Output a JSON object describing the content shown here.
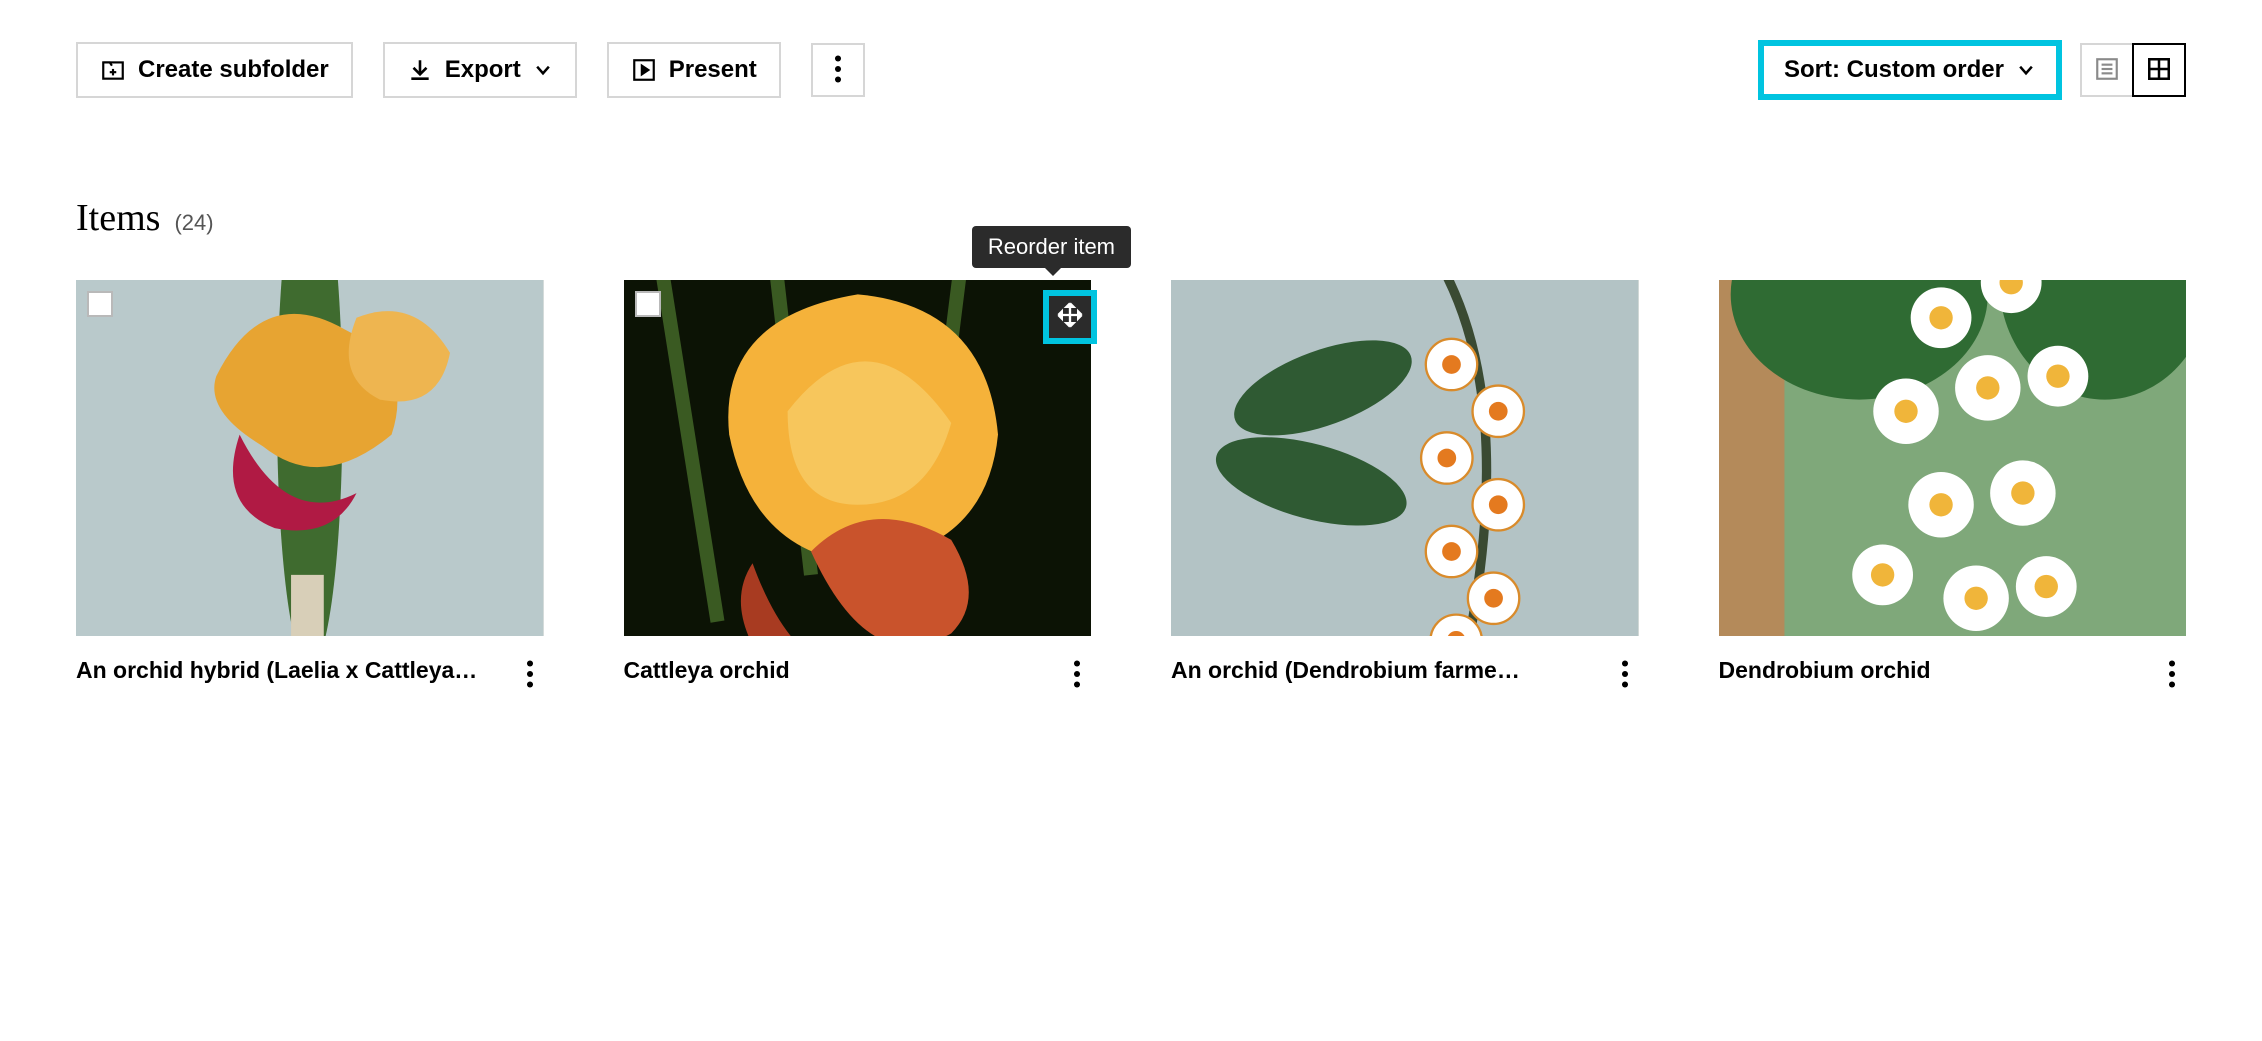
{
  "toolbar": {
    "create_subfolder_label": "Create subfolder",
    "export_label": "Export",
    "present_label": "Present",
    "sort_label": "Sort: Custom order"
  },
  "section": {
    "title": "Items",
    "count_label": "(24)"
  },
  "tooltip": {
    "reorder": "Reorder item"
  },
  "items": [
    {
      "title": "An orchid hybrid (Laelia x Cattleya…"
    },
    {
      "title": "Cattleya orchid"
    },
    {
      "title": "An orchid (Dendrobium farme…"
    },
    {
      "title": "Dendrobium orchid"
    }
  ]
}
